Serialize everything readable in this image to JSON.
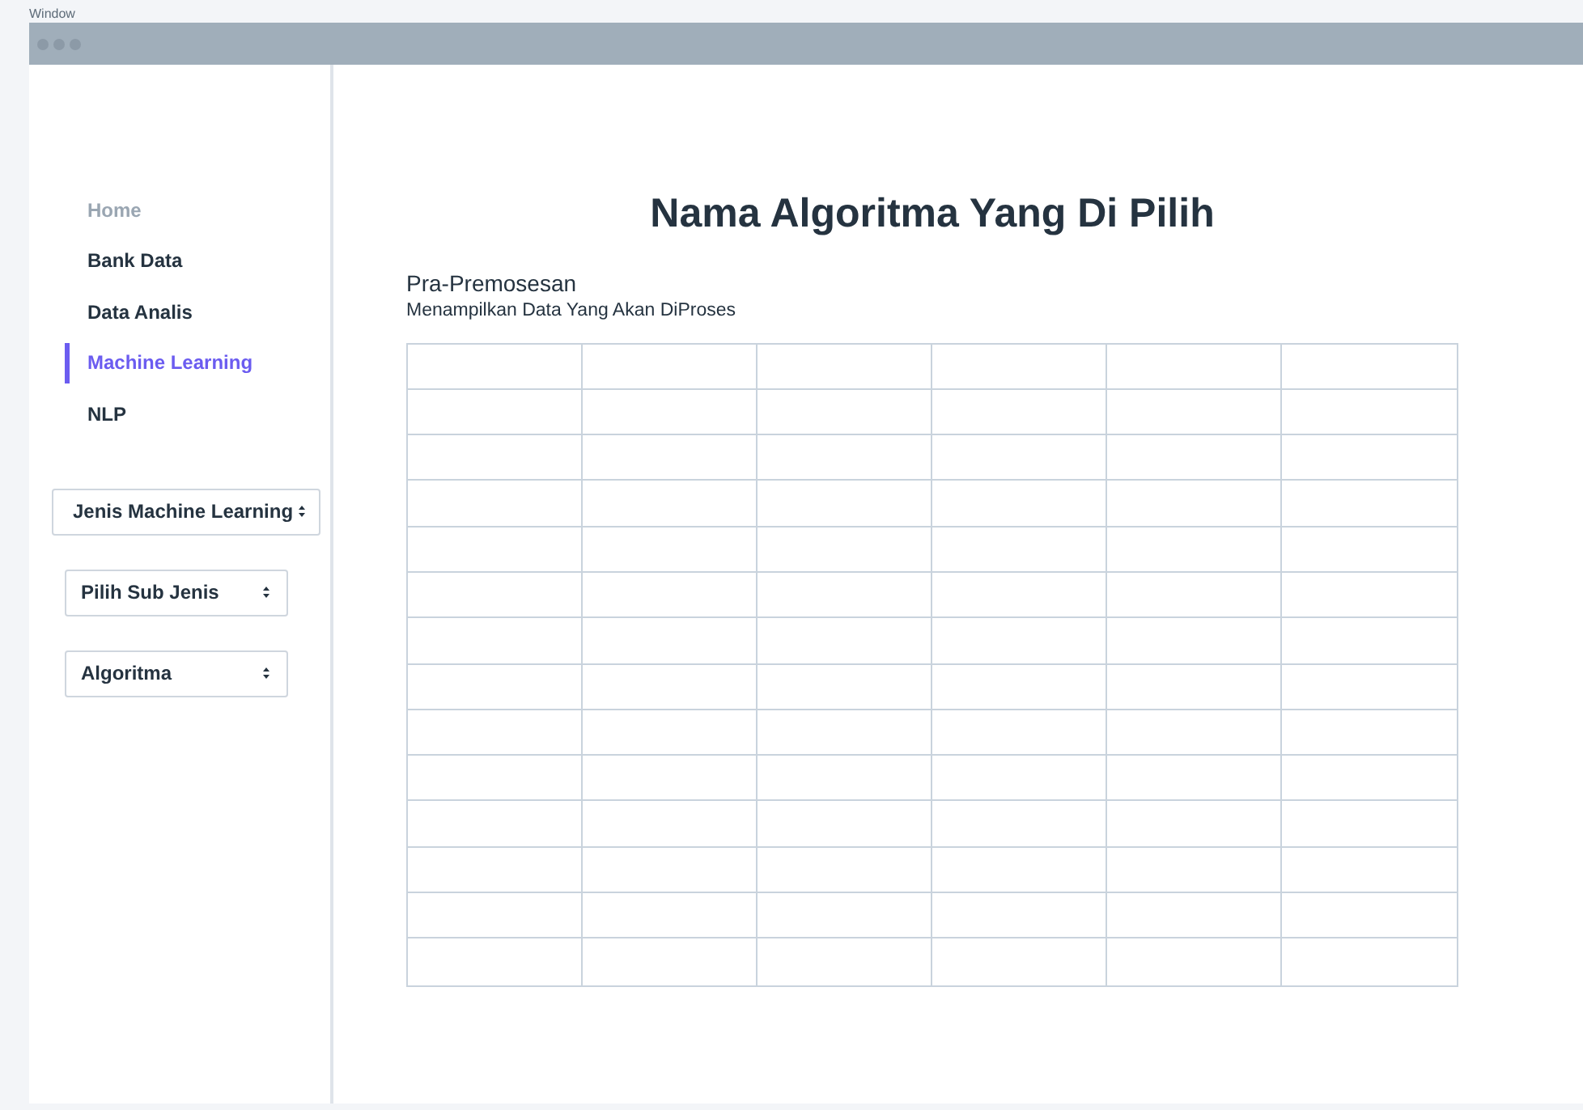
{
  "caption": "Window",
  "window": {
    "title_bar": {
      "kind": "traffic-lights"
    }
  },
  "sidebar": {
    "items": [
      {
        "label": "Home",
        "selected": false,
        "disabled": true
      },
      {
        "label": "Bank Data",
        "selected": false,
        "disabled": false
      },
      {
        "label": "Data Analis",
        "selected": false,
        "disabled": false
      },
      {
        "label": "Machine Learning",
        "selected": true,
        "disabled": false
      },
      {
        "label": "NLP",
        "selected": false,
        "disabled": false
      }
    ],
    "selects": [
      {
        "value": "Jenis Machine Learning",
        "kind": "wide"
      },
      {
        "value": "Pilih Sub Jenis",
        "kind": "narrow"
      },
      {
        "value": "Algoritma",
        "kind": "narrow"
      }
    ]
  },
  "main": {
    "title": "Nama Algoritma Yang Di Pilih",
    "section": "Pra-Premosesan",
    "description": "Menampilkan Data Yang Akan DiProses"
  }
}
